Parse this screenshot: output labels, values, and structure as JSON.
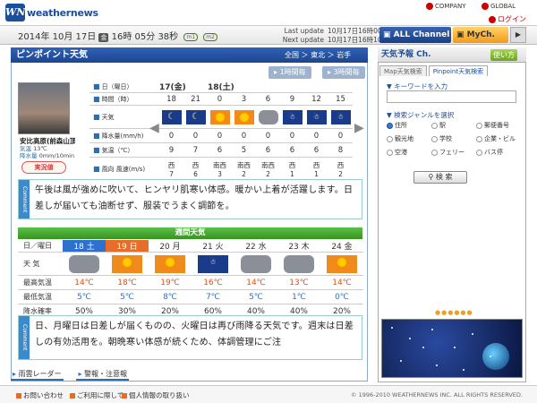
{
  "header": {
    "logo": "WN",
    "brand": "weathernews",
    "company": "COMPANY",
    "global": "GLOBAL",
    "login": "ログイン"
  },
  "datebar": {
    "date": "2014年 10月 17日",
    "weekday": "金",
    "time": "16時 05分 38秒",
    "badge1": "m1",
    "badge2": "m2",
    "last_update_label": "Last update",
    "last_update": "10月17日16時00分",
    "next_update_label": "Next update",
    "next_update": "10月17日16時10分",
    "all_channel": "ALL Channel",
    "mych": "MyCh."
  },
  "pinpoint": {
    "title": "ピンポイント天気",
    "crumb_all": "全国",
    "crumb_region": "東北",
    "crumb_pref": "岩手",
    "tab_1h": "1時間毎",
    "tab_3h": "3時間毎",
    "camera": {
      "name": "安比高原(前森山頂)",
      "temp_label": "気温",
      "temp": "13℃",
      "rain_label": "降水量",
      "rain": "0mm/10min",
      "report": "実況値"
    },
    "row_labels": [
      "日（曜日）",
      "時間（時）",
      "天気",
      "降水量(mm/h)",
      "気温（℃）",
      "風向 風速(m/s)"
    ],
    "days": [
      "17(金)",
      "18(土)"
    ],
    "hours": [
      "18",
      "21",
      "0",
      "3",
      "6",
      "9",
      "12",
      "15"
    ],
    "weather": [
      "moon",
      "moon",
      "sun",
      "sun",
      "cloud",
      "snow",
      "snow",
      "snow"
    ],
    "precip": [
      "0",
      "0",
      "0",
      "0",
      "0",
      "0",
      "0",
      "0"
    ],
    "temps": [
      "9",
      "7",
      "6",
      "5",
      "6",
      "6",
      "6",
      "8"
    ],
    "wind_dir": [
      "西",
      "西",
      "南西",
      "南西",
      "南西",
      "西",
      "西",
      "西"
    ],
    "wind_speed": [
      "7",
      "6",
      "3",
      "2",
      "2",
      "1",
      "1",
      "2"
    ],
    "comment_tab": "Comment",
    "comment": "午後は風が強めに吹いて、ヒンヤリ肌寒い体感。暖かい上着が活躍します。日差しが届いても油断せず、服装でうまく調節を。"
  },
  "weekly": {
    "title": "週間天気",
    "labels": [
      "日／曜日",
      "天 気",
      "最高気温",
      "最低気温",
      "降水確率"
    ],
    "days": [
      {
        "day": "18 土",
        "kind": "sat",
        "weather": "cloud",
        "hi": "14℃",
        "lo": "5℃",
        "pop": "50%"
      },
      {
        "day": "19 日",
        "kind": "sun",
        "weather": "sun",
        "hi": "18℃",
        "lo": "5℃",
        "pop": "30%"
      },
      {
        "day": "20 月",
        "kind": "",
        "weather": "sun",
        "hi": "19℃",
        "lo": "8℃",
        "pop": "20%"
      },
      {
        "day": "21 火",
        "kind": "",
        "weather": "snow",
        "hi": "16℃",
        "lo": "7℃",
        "pop": "60%"
      },
      {
        "day": "22 水",
        "kind": "",
        "weather": "cloud",
        "hi": "14℃",
        "lo": "5℃",
        "pop": "40%"
      },
      {
        "day": "23 木",
        "kind": "",
        "weather": "cloud",
        "hi": "13℃",
        "lo": "1℃",
        "pop": "40%"
      },
      {
        "day": "24 金",
        "kind": "",
        "weather": "sun",
        "hi": "14℃",
        "lo": "0℃",
        "pop": "20%"
      }
    ],
    "comment": "日、月曜日は日差しが届くものの、火曜日は再び雨降る天気です。週末は日差しの有効活用を。朝晩寒い体感が続くため、体調管理にご注"
  },
  "bottom_tabs": {
    "radar": "雨雲レーダー",
    "warning": "警報・注意報"
  },
  "right": {
    "title": "天気予報 Ch.",
    "use": "使い方",
    "tab_map": "Map天気検索",
    "tab_pin": "Pinpoint天気検索",
    "keyword_label": "キーワードを入力",
    "genre_label": "検索ジャンルを選択",
    "genres": [
      "住所",
      "駅",
      "郵便番号",
      "観光地",
      "学校",
      "企業・ビル",
      "空港",
      "フェリー",
      "バス停"
    ],
    "search": "検 索"
  },
  "footer": {
    "contact": "お問い合わせ",
    "terms": "ご利用に際して",
    "privacy": "個人情報の取り扱い",
    "copyright": "© 1996-2010 WEATHERNEWS INC. ALL RIGHTS RESERVED."
  }
}
